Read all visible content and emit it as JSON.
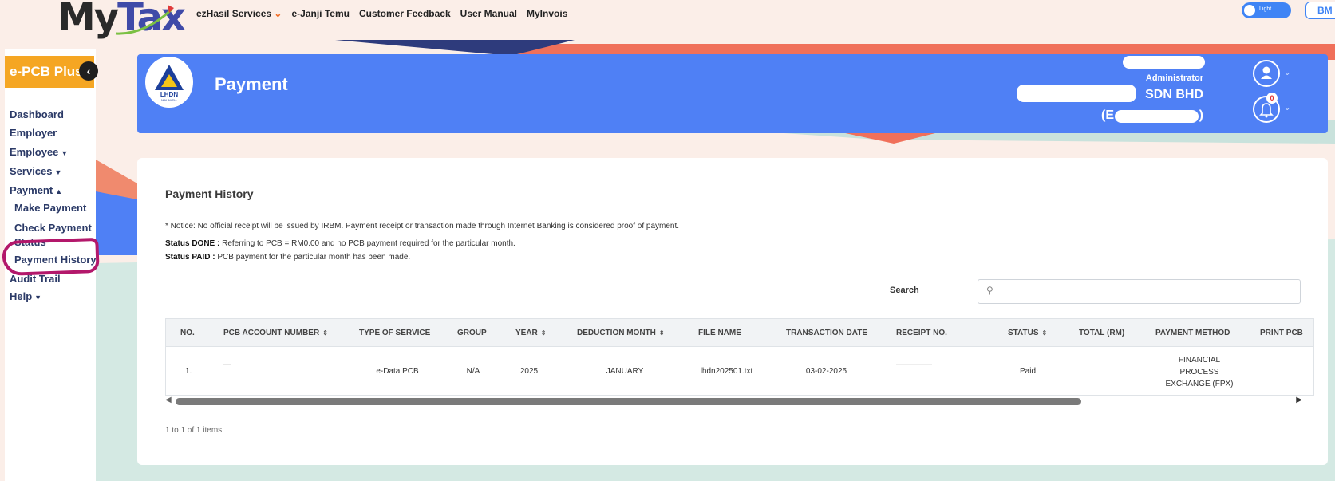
{
  "app": {
    "logo_my": "My",
    "logo_tax": "Tax"
  },
  "topnav": {
    "items": [
      {
        "label": "ezHasil Services",
        "active": true,
        "has_caret": true
      },
      {
        "label": "e-Janji Temu"
      },
      {
        "label": "Customer Feedback"
      },
      {
        "label": "User Manual"
      },
      {
        "label": "MyInvois"
      }
    ],
    "theme_toggle_label": "Light",
    "language_button": "BM"
  },
  "sidebar": {
    "brand": "e-PCB Plus",
    "items": [
      {
        "label": "Dashboard"
      },
      {
        "label": "Employer"
      },
      {
        "label": "Employee"
      },
      {
        "label": "Services"
      },
      {
        "label": "Payment"
      },
      {
        "label": "Make Payment"
      },
      {
        "label": "Check Payment Status"
      },
      {
        "label": "Payment History"
      },
      {
        "label": "Audit Trail"
      },
      {
        "label": "Help"
      }
    ]
  },
  "header": {
    "title": "Payment",
    "logo_text": "LHDN",
    "logo_subtext": "MALAYSIA",
    "user_role": "Administrator",
    "company_name": "SDN BHD",
    "company_id_prefix": "(E",
    "company_id_suffix": ")",
    "notification_count": "0"
  },
  "main": {
    "title": "Payment History",
    "notice": "* Notice: No official receipt will be issued by IRBM. Payment receipt or transaction made through Internet Banking is considered proof of payment.",
    "status_done_label": "Status DONE :",
    "status_done_text": "Referring to PCB = RM0.00 and no PCB payment required for the particular month.",
    "status_paid_label": "Status PAID :",
    "status_paid_text": "PCB payment for the particular month has been made.",
    "search_label": "Search",
    "search_value": "",
    "columns": [
      "NO.",
      "PCB ACCOUNT NUMBER",
      "TYPE OF SERVICE",
      "GROUP",
      "YEAR",
      "DEDUCTION MONTH",
      "FILE NAME",
      "TRANSACTION DATE",
      "RECEIPT NO.",
      "STATUS",
      "TOTAL (RM)",
      "PAYMENT METHOD",
      "PRINT PCB"
    ],
    "rows": [
      {
        "no": "1.",
        "type_of_service": "e-Data PCB",
        "group": "N/A",
        "year": "2025",
        "deduction_month": "JANUARY",
        "file_name": "lhdn202501.txt",
        "transaction_date": "03-02-2025",
        "status": "Paid",
        "payment_method_line1": "FINANCIAL",
        "payment_method_line2": "PROCESS",
        "payment_method_line3": "EXCHANGE (FPX)"
      }
    ],
    "pager_text": "1 to 1 of 1 items"
  },
  "colors": {
    "banner": "#4f80f5",
    "brand_orange": "#f5a623",
    "nav_active": "#f26a21",
    "highlight_ring": "#b3186b",
    "sidebar_text": "#2b3a67"
  },
  "icons": {
    "search": "search-icon",
    "user": "user-icon",
    "bell": "bell-icon",
    "collapse": "chevron-left-icon"
  }
}
